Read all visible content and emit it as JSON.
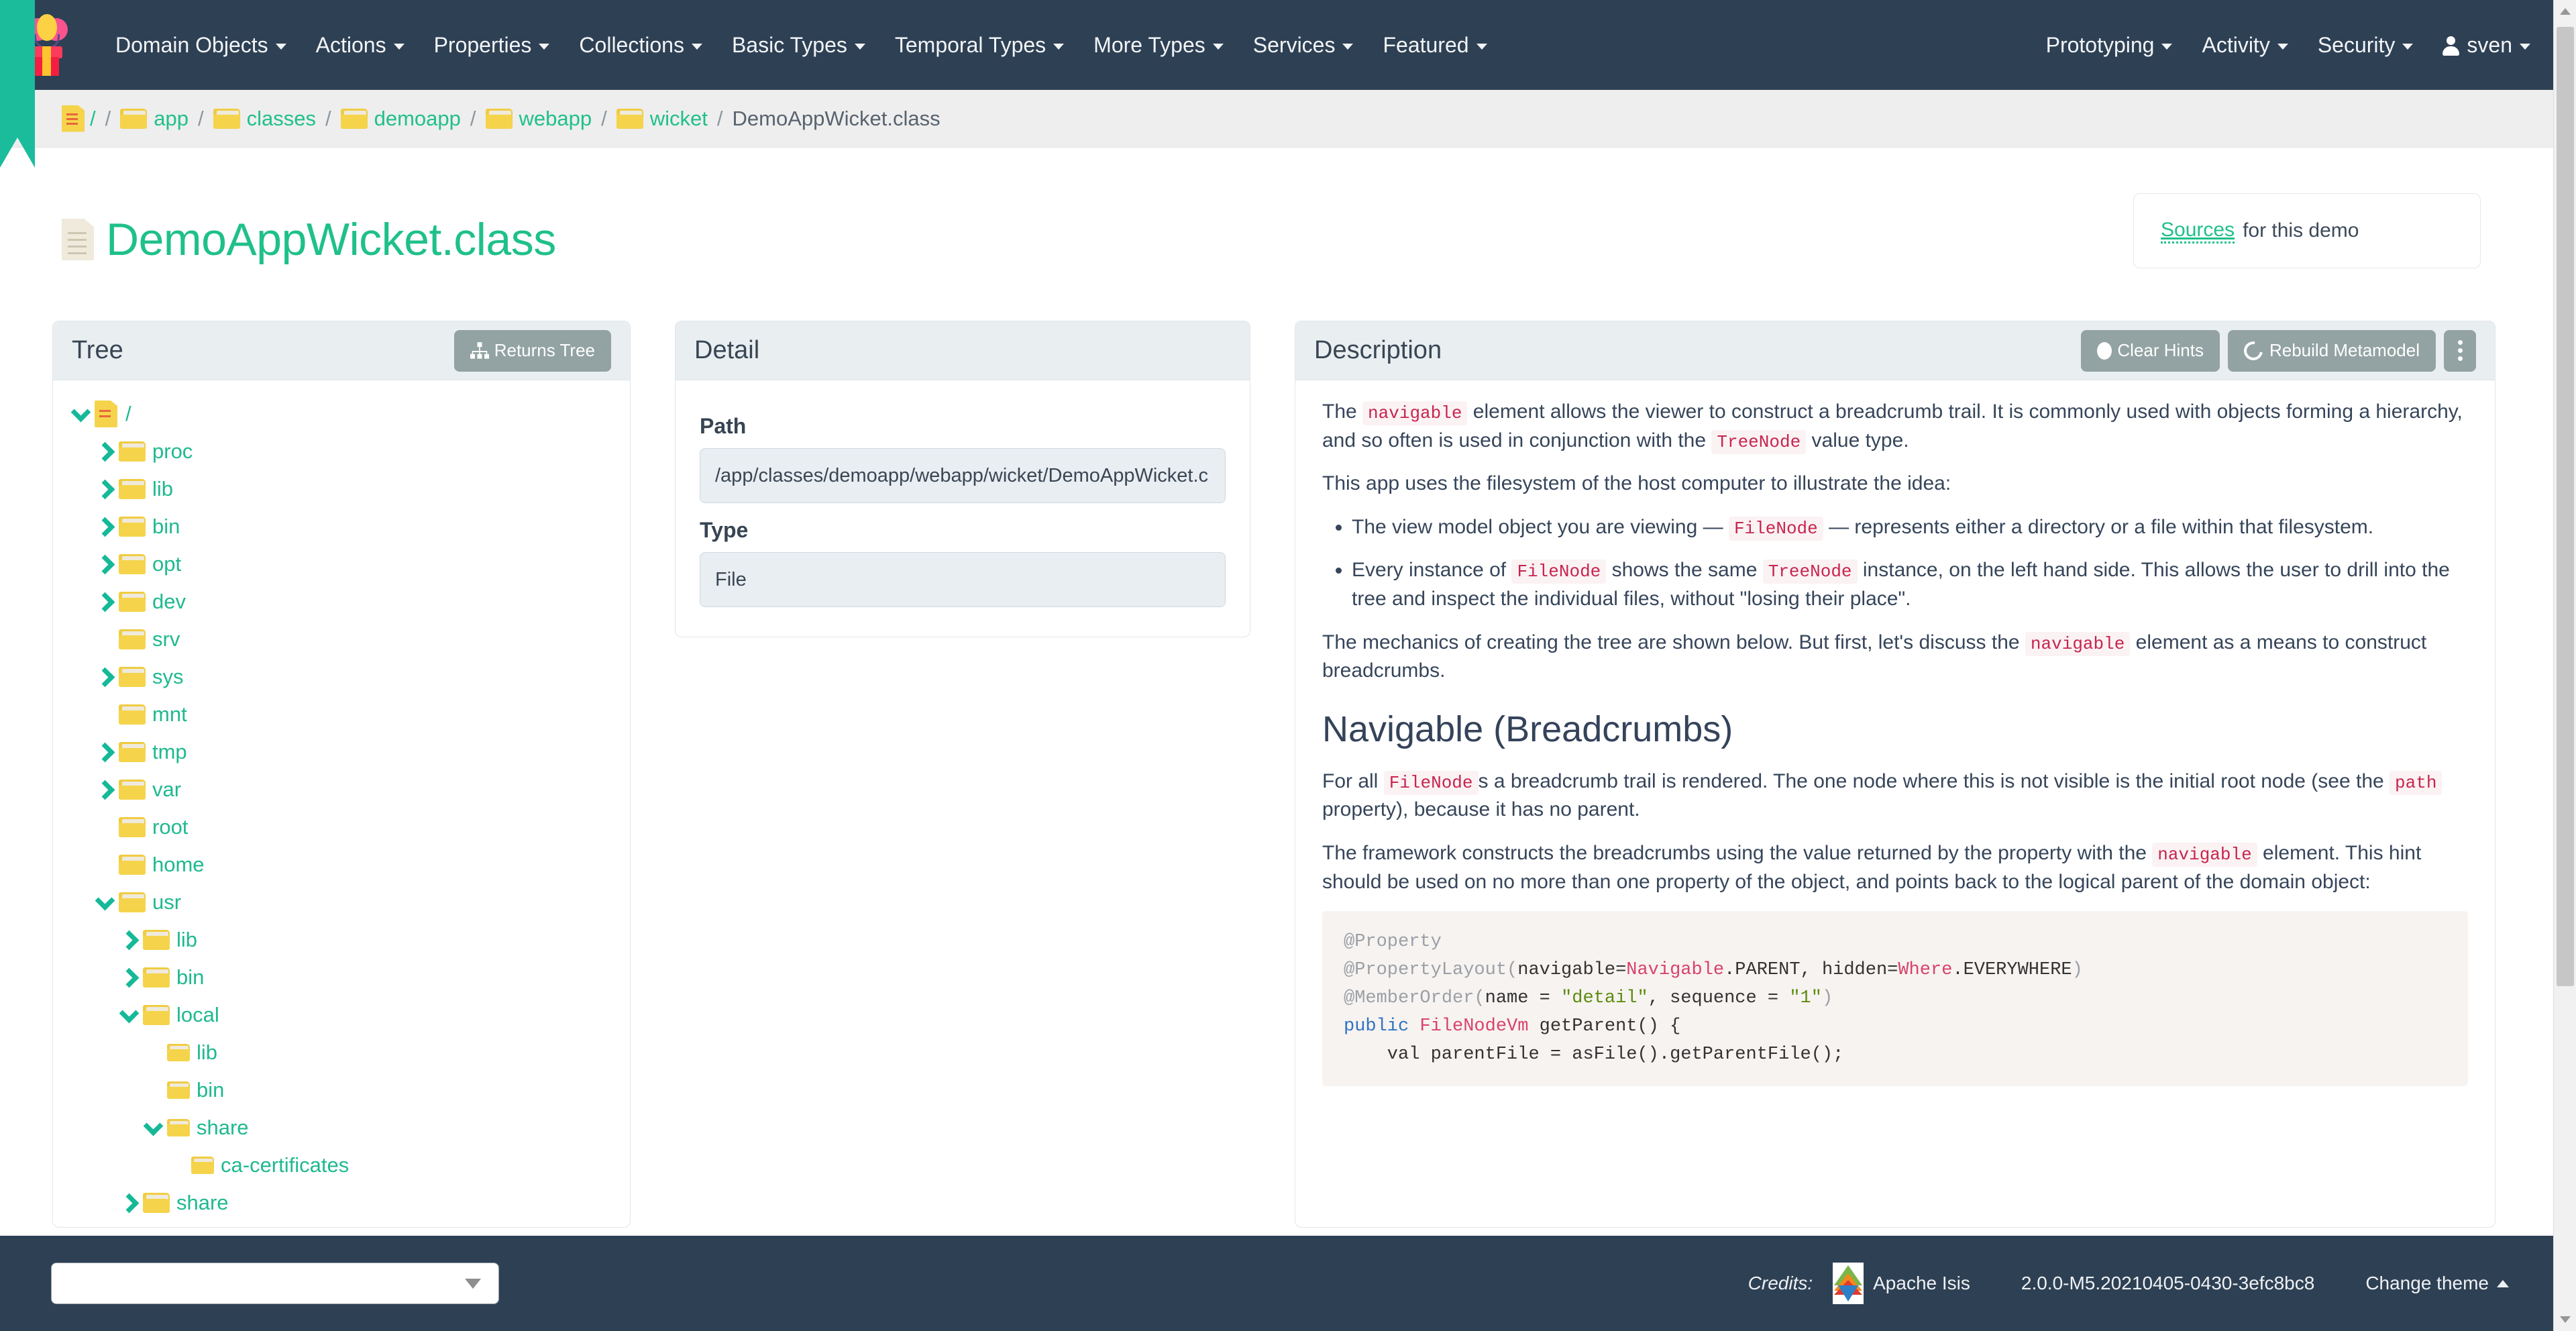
{
  "navbar": {
    "brand_icon": "flower-pot-logo",
    "left_items": [
      {
        "label": "Domain Objects",
        "caret": true
      },
      {
        "label": "Actions",
        "caret": true
      },
      {
        "label": "Properties",
        "caret": true
      },
      {
        "label": "Collections",
        "caret": true
      },
      {
        "label": "Basic Types",
        "caret": true
      },
      {
        "label": "Temporal Types",
        "caret": true
      },
      {
        "label": "More Types",
        "caret": true
      },
      {
        "label": "Services",
        "caret": true
      },
      {
        "label": "Featured",
        "caret": true
      }
    ],
    "right_items": [
      {
        "label": "Prototyping",
        "caret": true
      },
      {
        "label": "Activity",
        "caret": true
      },
      {
        "label": "Security",
        "caret": true
      }
    ],
    "user": {
      "label": "sven",
      "icon": "user-icon",
      "caret": true
    }
  },
  "breadcrumb": {
    "root_icon": "file-lines-icon",
    "items": [
      {
        "label": "/",
        "icon": null,
        "link": true
      },
      {
        "label": "app",
        "icon": "folder-icon",
        "link": true
      },
      {
        "label": "classes",
        "icon": "folder-icon",
        "link": true
      },
      {
        "label": "demoapp",
        "icon": "folder-icon",
        "link": true
      },
      {
        "label": "webapp",
        "icon": "folder-icon",
        "link": true
      },
      {
        "label": "wicket",
        "icon": "folder-icon",
        "link": true
      },
      {
        "label": "DemoAppWicket.class",
        "icon": null,
        "link": false
      }
    ],
    "separator": "/"
  },
  "page": {
    "title": "DemoAppWicket.class",
    "title_icon": "document-icon"
  },
  "sources": {
    "link_label": "Sources",
    "suffix": " for this demo"
  },
  "tree_panel": {
    "title": "Tree",
    "action_label": "Returns Tree",
    "action_icon": "sitemap-icon",
    "nodes": [
      {
        "label": "/",
        "depth": 0,
        "arrow": "down",
        "icon": "root-folder-icon"
      },
      {
        "label": "proc",
        "depth": 1,
        "arrow": "right",
        "icon": "folder-icon"
      },
      {
        "label": "lib",
        "depth": 1,
        "arrow": "right",
        "icon": "folder-icon"
      },
      {
        "label": "bin",
        "depth": 1,
        "arrow": "right",
        "icon": "folder-icon"
      },
      {
        "label": "opt",
        "depth": 1,
        "arrow": "right",
        "icon": "folder-icon"
      },
      {
        "label": "dev",
        "depth": 1,
        "arrow": "right",
        "icon": "folder-icon"
      },
      {
        "label": "srv",
        "depth": 1,
        "arrow": "none",
        "icon": "folder-icon"
      },
      {
        "label": "sys",
        "depth": 1,
        "arrow": "right",
        "icon": "folder-icon"
      },
      {
        "label": "mnt",
        "depth": 1,
        "arrow": "none",
        "icon": "folder-icon"
      },
      {
        "label": "tmp",
        "depth": 1,
        "arrow": "right",
        "icon": "folder-icon"
      },
      {
        "label": "var",
        "depth": 1,
        "arrow": "right",
        "icon": "folder-icon"
      },
      {
        "label": "root",
        "depth": 1,
        "arrow": "none",
        "icon": "folder-icon"
      },
      {
        "label": "home",
        "depth": 1,
        "arrow": "none",
        "icon": "folder-icon"
      },
      {
        "label": "usr",
        "depth": 1,
        "arrow": "down",
        "icon": "folder-icon"
      },
      {
        "label": "lib",
        "depth": 2,
        "arrow": "right",
        "icon": "folder-icon"
      },
      {
        "label": "bin",
        "depth": 2,
        "arrow": "right",
        "icon": "folder-icon"
      },
      {
        "label": "local",
        "depth": 2,
        "arrow": "down",
        "icon": "folder-icon"
      },
      {
        "label": "lib",
        "depth": 3,
        "arrow": "none",
        "icon": "folder-icon"
      },
      {
        "label": "bin",
        "depth": 3,
        "arrow": "none",
        "icon": "folder-icon"
      },
      {
        "label": "share",
        "depth": 3,
        "arrow": "down",
        "icon": "folder-icon"
      },
      {
        "label": "ca-certificates",
        "depth": 4,
        "arrow": "none",
        "icon": "folder-icon"
      },
      {
        "label": "share",
        "depth": 2,
        "arrow": "right",
        "icon": "folder-icon"
      }
    ]
  },
  "detail_panel": {
    "title": "Detail",
    "fields": [
      {
        "label": "Path",
        "value": "/app/classes/demoapp/webapp/wicket/DemoAppWicket.c"
      },
      {
        "label": "Type",
        "value": "File"
      }
    ]
  },
  "description_panel": {
    "title": "Description",
    "buttons": [
      {
        "label": "Clear Hints",
        "icon": "circle-icon"
      },
      {
        "label": "Rebuild Metamodel",
        "icon": "recycle-icon"
      },
      {
        "label": "",
        "icon": "kebab-icon"
      }
    ],
    "para1": {
      "a": "The ",
      "code1": "navigable",
      "b": " element allows the viewer to construct a breadcrumb trail. It is commonly used with objects forming a hierarchy, and so often is used in conjunction with the ",
      "code2": "TreeNode",
      "c": " value type."
    },
    "para2": "This app uses the filesystem of the host computer to illustrate the idea:",
    "bullet1": {
      "a": "The view model object you are viewing — ",
      "code1": "FileNode",
      "b": " — represents either a directory or a file within that filesystem."
    },
    "bullet2": {
      "a": "Every instance of ",
      "code1": "FileNode",
      "b": " shows the same ",
      "code2": "TreeNode",
      "c": " instance, on the left hand side. This allows the user to drill into the tree and inspect the individual files, without \"losing their place\"."
    },
    "para3": {
      "a": "The mechanics of creating the tree are shown below. But first, let's discuss the ",
      "code1": "navigable",
      "b": " element as a means to construct breadcrumbs."
    },
    "heading2": "Navigable (Breadcrumbs)",
    "para4": {
      "a": "For all ",
      "code1": "FileNode",
      "b": "s a breadcrumb trail is rendered. The one node where this is not visible is the initial root node (see the ",
      "code2": "path",
      "c": " property), because it has no parent."
    },
    "para5": {
      "a": "The framework constructs the breadcrumbs using the value returned by the property with the ",
      "code1": "navigable",
      "b": " element. This hint should be used on no more than one property of the object, and points back to the logical parent of the domain object:"
    },
    "code_lines": [
      [
        {
          "t": "@Property",
          "c": "ann"
        }
      ],
      [
        {
          "t": "@PropertyLayout(",
          "c": "ann"
        },
        {
          "t": "navigable",
          "c": "pl"
        },
        {
          "t": "=",
          "c": "pl"
        },
        {
          "t": "Navigable",
          "c": "typ"
        },
        {
          "t": ".PARENT, ",
          "c": "pl"
        },
        {
          "t": "hidden",
          "c": "pl"
        },
        {
          "t": "=",
          "c": "pl"
        },
        {
          "t": "Where",
          "c": "typ"
        },
        {
          "t": ".EVERYWHERE",
          "c": "pl"
        },
        {
          "t": ")",
          "c": "ann"
        }
      ],
      [
        {
          "t": "@MemberOrder(",
          "c": "ann"
        },
        {
          "t": "name",
          "c": "pl"
        },
        {
          "t": " = ",
          "c": "pl"
        },
        {
          "t": "\"detail\"",
          "c": "str"
        },
        {
          "t": ", ",
          "c": "pl"
        },
        {
          "t": "sequence",
          "c": "pl"
        },
        {
          "t": " = ",
          "c": "pl"
        },
        {
          "t": "\"1\"",
          "c": "str"
        },
        {
          "t": ")",
          "c": "ann"
        }
      ],
      [
        {
          "t": "public",
          "c": "kw"
        },
        {
          "t": " ",
          "c": "pl"
        },
        {
          "t": "FileNodeVm",
          "c": "typ"
        },
        {
          "t": " getParent",
          "c": "pl"
        },
        {
          "t": "() {",
          "c": "pl"
        }
      ],
      [
        {
          "t": "    val parentFile = asFile().getParentFile();",
          "c": "pl"
        }
      ]
    ]
  },
  "footer": {
    "theme_select_value": "",
    "credits_label": "Credits:",
    "product_name": "Apache Isis",
    "version": "2.0.0-M5.20210405-0430-3efc8bc8",
    "change_theme_label": "Change theme"
  }
}
